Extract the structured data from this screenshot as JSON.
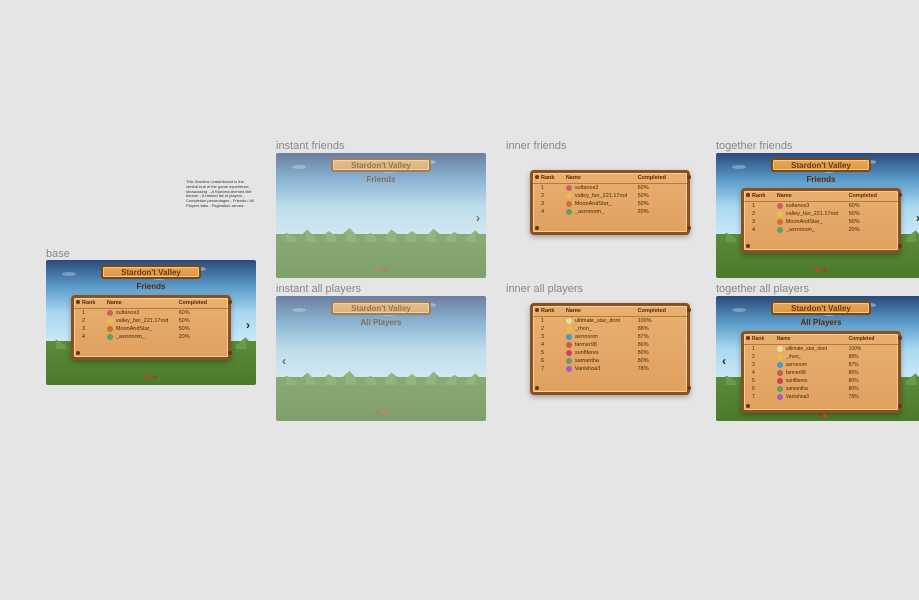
{
  "labels": {
    "base": "base",
    "instant_friends": "instant friends",
    "inner_friends": "inner friends",
    "together_friends": "together friends",
    "instant_all": "instant all players",
    "inner_all": "inner all players",
    "together_all": "together all players"
  },
  "mini_text": "This Stardew Leaderboard is the central hub of the game experience, showcasing:\n- A Stardew-themed title banner\n- A ranked list of players\n- Completion percentages\n- Friends / All Players tabs\n- Pagination arrows",
  "game_title": "Stardon't Valley",
  "subtitles": {
    "friends": "Friends",
    "all_players": "All Players"
  },
  "columns": {
    "rank": "Rank",
    "name": "Name",
    "completed": "Completed"
  },
  "friends_rows": [
    {
      "rank": "1",
      "name": "sultanos3",
      "completed": "60%",
      "color": "#d06060"
    },
    {
      "rank": "2",
      "name": "valley_fan_221.17rod",
      "completed": "50%",
      "color": "#e8c040"
    },
    {
      "rank": "3",
      "name": "MoonAndStar_",
      "completed": "50%",
      "color": "#d07030"
    },
    {
      "rank": "4",
      "name": "_asrronom_",
      "completed": "20%",
      "color": "#60a060"
    }
  ],
  "all_players_rows": [
    {
      "rank": "1",
      "name": "ultimate_star_dont",
      "completed": "100%",
      "color": "#e0e0a0"
    },
    {
      "rank": "2",
      "name": "_rhon_",
      "completed": "88%",
      "color": "#e8c040"
    },
    {
      "rank": "3",
      "name": "asrronom",
      "completed": "87%",
      "color": "#40a0c0"
    },
    {
      "rank": "4",
      "name": "farmer98",
      "completed": "86%",
      "color": "#c06040"
    },
    {
      "rank": "5",
      "name": "sunflteres",
      "completed": "80%",
      "color": "#d04060"
    },
    {
      "rank": "6",
      "name": "samantha",
      "completed": "80%",
      "color": "#60a060"
    },
    {
      "rank": "7",
      "name": "Vanishoa3",
      "completed": "78%",
      "color": "#a060c0"
    }
  ],
  "nav": {
    "left": "‹",
    "right": "›"
  }
}
